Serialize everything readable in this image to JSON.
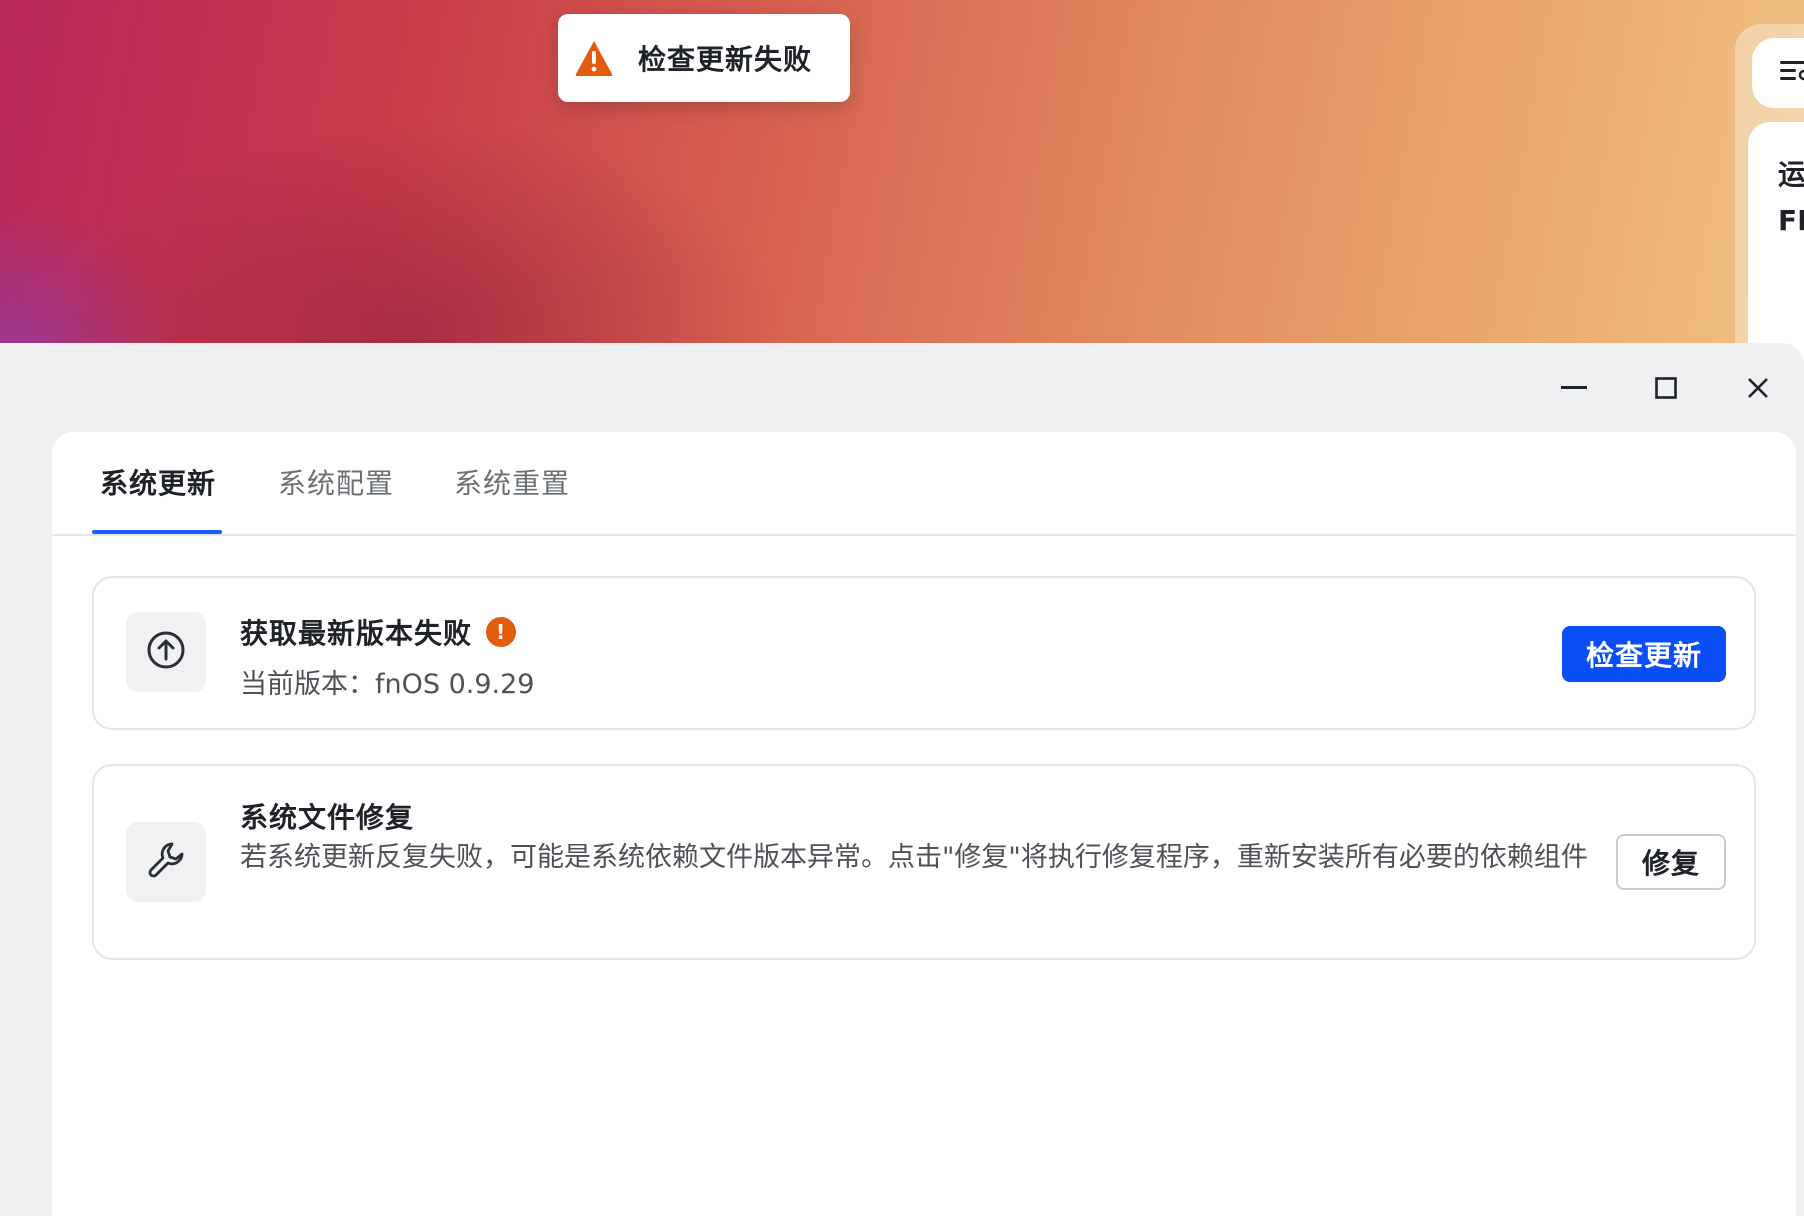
{
  "toast": {
    "icon": "warning-triangle-icon",
    "color": "#e35b0e",
    "message": "检查更新失败"
  },
  "edge_widget": {
    "icon": "filter-settings-icon",
    "card_line1": "运",
    "card_line2": "FI"
  },
  "window": {
    "controls": [
      "minimize-icon",
      "maximize-icon",
      "close-icon"
    ]
  },
  "tabs": [
    {
      "label": "系统更新",
      "active": true
    },
    {
      "label": "系统配置",
      "active": false
    },
    {
      "label": "系统重置",
      "active": false
    }
  ],
  "accent_color": "#1a5cff",
  "update_card": {
    "icon": "arrow-up-circle-icon",
    "title": "获取最新版本失败",
    "status_icon": "exclamation-icon",
    "status_symbol": "!",
    "status_color": "#e35b0e",
    "current_version": "当前版本：fnOS 0.9.29",
    "button_label": "检查更新"
  },
  "repair_card": {
    "icon": "wrench-icon",
    "title": "系统文件修复",
    "description": "若系统更新反复失败，可能是系统依赖文件版本异常。点击\"修复\"将执行修复程序，重新安装所有必要的依赖组件",
    "button_label": "修复"
  }
}
